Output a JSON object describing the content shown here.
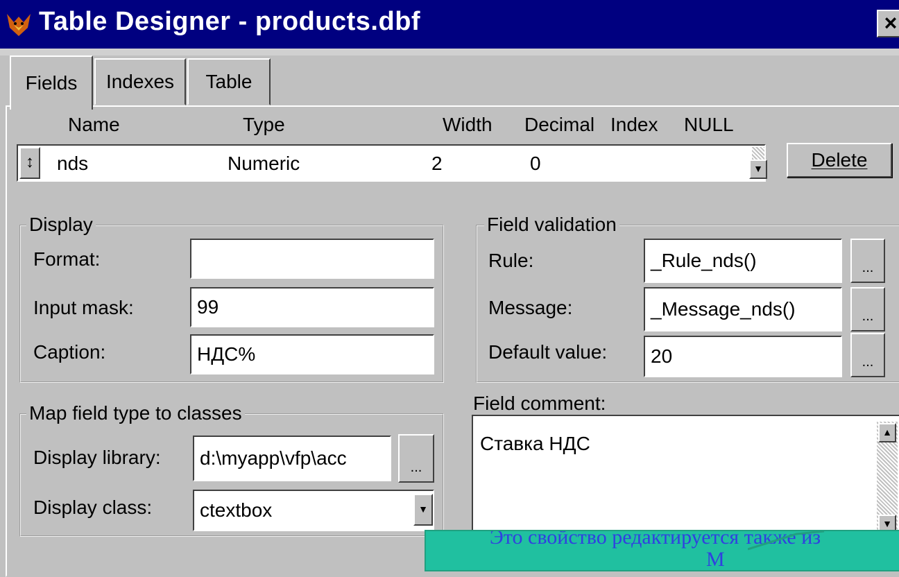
{
  "window": {
    "title": "Table Designer - products.dbf",
    "close_label": "×",
    "icon": "foxpro-icon"
  },
  "tabs": [
    {
      "label": "Fields",
      "active": true
    },
    {
      "label": "Indexes",
      "active": false
    },
    {
      "label": "Table",
      "active": false
    }
  ],
  "grid": {
    "columns": [
      "Name",
      "Type",
      "Width",
      "Decimal",
      "Index",
      "NULL"
    ],
    "row": {
      "mover": "↕",
      "name": "nds",
      "type": "Numeric",
      "width": "2",
      "decimal": "0"
    },
    "scroll_down": "▼",
    "delete_label": "Delete"
  },
  "display": {
    "legend": "Display",
    "format_label": "Format:",
    "format_value": "",
    "input_mask_label": "Input mask:",
    "input_mask_value": "99",
    "caption_label": "Caption:",
    "caption_value": "НДС%"
  },
  "validation": {
    "legend": "Field validation",
    "rule_label": "Rule:",
    "rule_value": "_Rule_nds()",
    "message_label": "Message:",
    "message_value": "_Message_nds()",
    "default_label": "Default value:",
    "default_value": "20",
    "ellipsis": "..."
  },
  "map": {
    "legend": "Map field type to classes",
    "library_label": "Display library:",
    "library_value": "d:\\myapp\\vfp\\acc",
    "class_label": "Display class:",
    "class_value": "ctextbox",
    "dropdown": "▼",
    "ellipsis": "..."
  },
  "comment": {
    "label": "Field comment:",
    "value": "Ставка НДС",
    "scroll_up": "▲",
    "scroll_down": "▼"
  },
  "callout": {
    "line1": "Это свойство редактируется также из",
    "line2": "М"
  },
  "colors": {
    "titlebar": "#000080",
    "face": "#c0c0c0",
    "callout_bg": "#20c0a0",
    "callout_text": "#3040e0"
  }
}
